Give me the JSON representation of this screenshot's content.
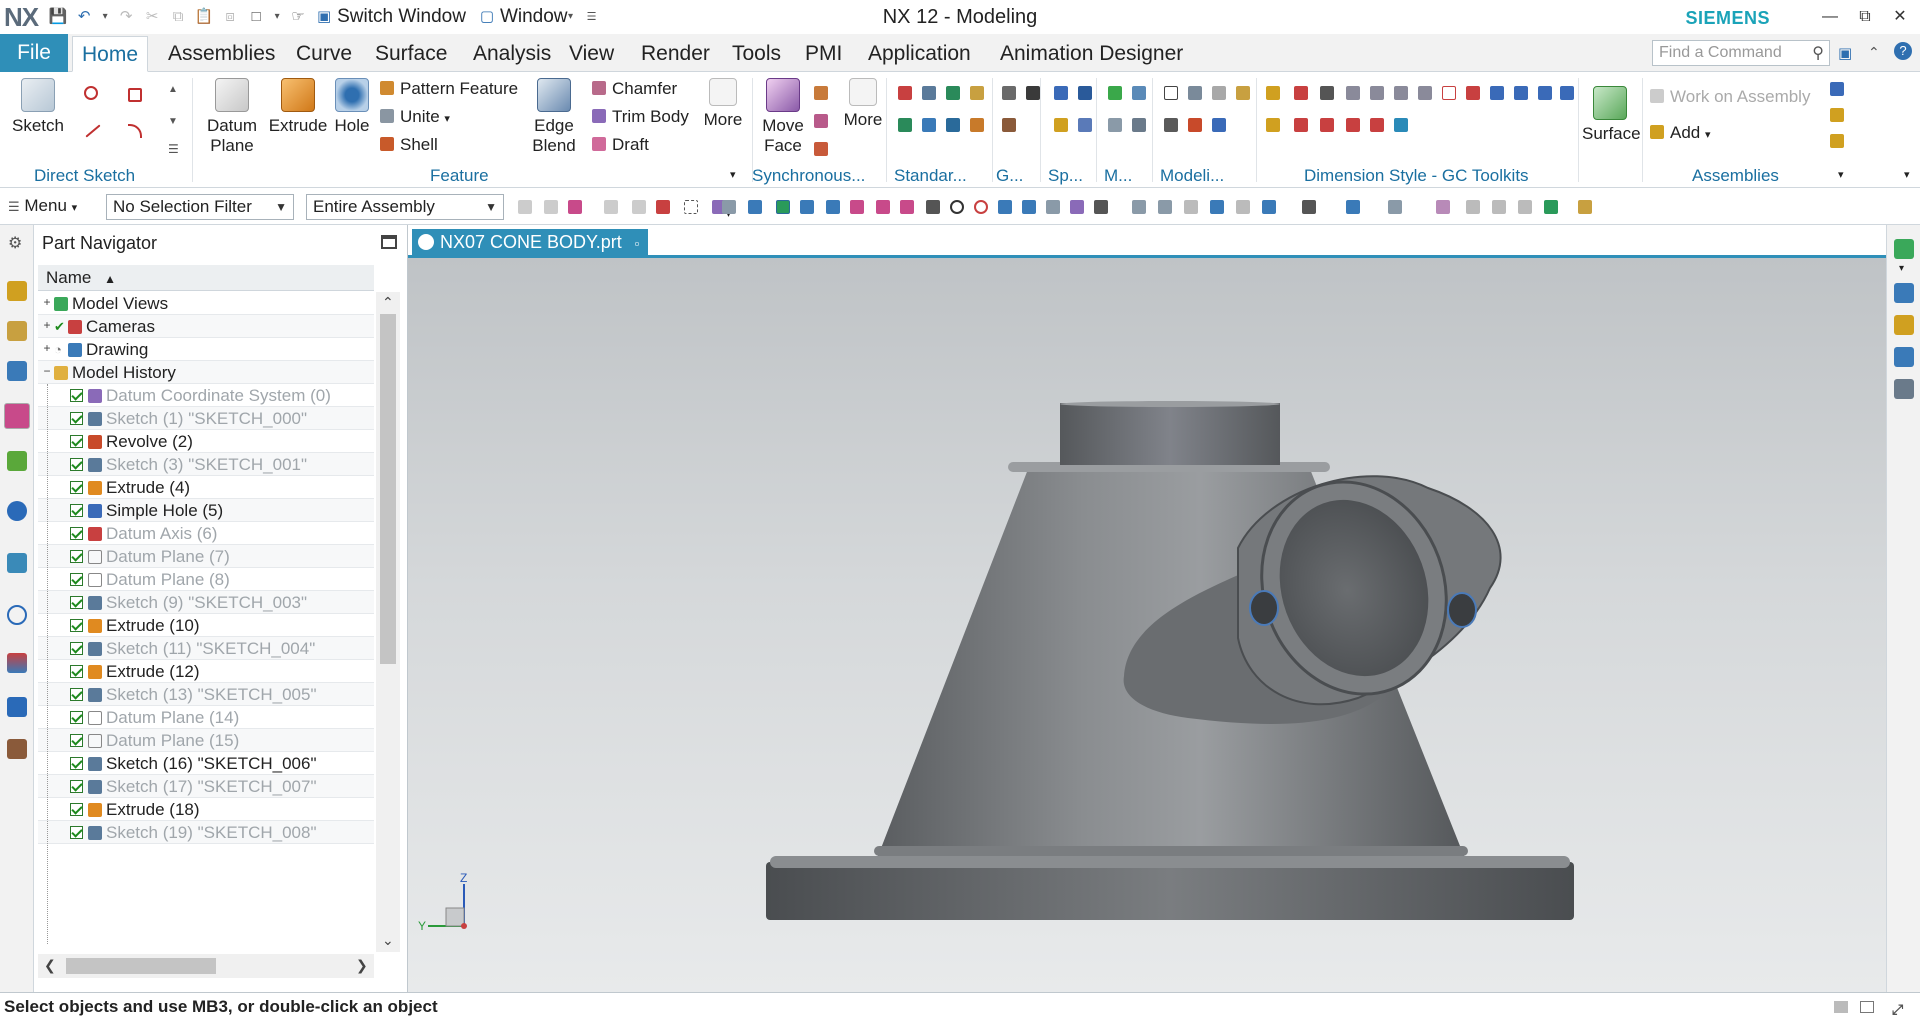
{
  "titlebar": {
    "logo": "NX",
    "switch_window": "Switch Window",
    "window_menu": "Window",
    "title": "NX 12 - Modeling",
    "brand": "SIEMENS"
  },
  "menu_tabs": [
    "File",
    "Home",
    "Assemblies",
    "Curve",
    "Surface",
    "Analysis",
    "View",
    "Render",
    "Tools",
    "PMI",
    "Application",
    "Animation Designer"
  ],
  "command_search": {
    "placeholder": "Find a Command"
  },
  "ribbon": {
    "sketch": "Sketch",
    "datum_plane": "Datum Plane",
    "extrude": "Extrude",
    "hole": "Hole",
    "pattern_feature": "Pattern Feature",
    "unite": "Unite",
    "shell": "Shell",
    "edge_blend": "Edge Blend",
    "chamfer": "Chamfer",
    "trim_body": "Trim Body",
    "draft": "Draft",
    "more1": "More",
    "move_face": "Move Face",
    "more2": "More",
    "surface": "Surface",
    "work_on_assembly": "Work on Assembly",
    "add": "Add",
    "groups": {
      "direct_sketch": "Direct Sketch",
      "feature": "Feature",
      "synchronous": "Synchronous...",
      "standard": "Standar...",
      "g": "G...",
      "sp": "Sp...",
      "m": "M...",
      "modeling": "Modeli...",
      "dimension_style": "Dimension Style - GC Toolkits",
      "assemblies": "Assemblies"
    }
  },
  "selbar": {
    "menu": "Menu",
    "selection_filter": "No Selection Filter",
    "scope": "Entire Assembly"
  },
  "navigator": {
    "title": "Part Navigator",
    "column": "Name",
    "rows": [
      {
        "label": "Model Views",
        "level": 0,
        "suppressed": false,
        "icon": "model-views-icon"
      },
      {
        "label": "Cameras",
        "level": 0,
        "suppressed": false,
        "icon": "camera-icon"
      },
      {
        "label": "Drawing",
        "level": 0,
        "suppressed": false,
        "icon": "drawing-icon"
      },
      {
        "label": "Model History",
        "level": 0,
        "suppressed": false,
        "icon": "folder-icon"
      },
      {
        "label": "Datum Coordinate System (0)",
        "level": 1,
        "suppressed": true,
        "icon": "datum-csys-icon"
      },
      {
        "label": "Sketch (1) \"SKETCH_000\"",
        "level": 1,
        "suppressed": true,
        "icon": "sketch-icon"
      },
      {
        "label": "Revolve (2)",
        "level": 1,
        "suppressed": false,
        "icon": "revolve-icon"
      },
      {
        "label": "Sketch (3) \"SKETCH_001\"",
        "level": 1,
        "suppressed": true,
        "icon": "sketch-icon"
      },
      {
        "label": "Extrude (4)",
        "level": 1,
        "suppressed": false,
        "icon": "extrude-icon"
      },
      {
        "label": "Simple Hole (5)",
        "level": 1,
        "suppressed": false,
        "icon": "hole-icon"
      },
      {
        "label": "Datum Axis (6)",
        "level": 1,
        "suppressed": true,
        "icon": "datum-axis-icon"
      },
      {
        "label": "Datum Plane (7)",
        "level": 1,
        "suppressed": true,
        "icon": "datum-plane-icon"
      },
      {
        "label": "Datum Plane (8)",
        "level": 1,
        "suppressed": true,
        "icon": "datum-plane-icon"
      },
      {
        "label": "Sketch (9) \"SKETCH_003\"",
        "level": 1,
        "suppressed": true,
        "icon": "sketch-icon"
      },
      {
        "label": "Extrude (10)",
        "level": 1,
        "suppressed": false,
        "icon": "extrude-icon"
      },
      {
        "label": "Sketch (11) \"SKETCH_004\"",
        "level": 1,
        "suppressed": true,
        "icon": "sketch-icon"
      },
      {
        "label": "Extrude (12)",
        "level": 1,
        "suppressed": false,
        "icon": "extrude-icon"
      },
      {
        "label": "Sketch (13) \"SKETCH_005\"",
        "level": 1,
        "suppressed": true,
        "icon": "sketch-icon"
      },
      {
        "label": "Datum Plane (14)",
        "level": 1,
        "suppressed": true,
        "icon": "datum-plane-icon"
      },
      {
        "label": "Datum Plane (15)",
        "level": 1,
        "suppressed": true,
        "icon": "datum-plane-icon"
      },
      {
        "label": "Sketch (16) \"SKETCH_006\"",
        "level": 1,
        "suppressed": false,
        "icon": "sketch-icon"
      },
      {
        "label": "Sketch (17) \"SKETCH_007\"",
        "level": 1,
        "suppressed": true,
        "icon": "sketch-icon"
      },
      {
        "label": "Extrude (18)",
        "level": 1,
        "suppressed": false,
        "icon": "extrude-icon"
      },
      {
        "label": "Sketch (19) \"SKETCH_008\"",
        "level": 1,
        "suppressed": true,
        "icon": "sketch-icon"
      }
    ]
  },
  "document_tab": "NX07 CONE BODY.prt",
  "triad": {
    "z": "Z",
    "y": "Y"
  },
  "status": "Select objects and use MB3, or double-click an object",
  "colors": {
    "accent": "#2f8fb8",
    "brand": "#1aa3b8",
    "suppressed_text": "#a0a6ab",
    "check": "#1d8a1d"
  }
}
